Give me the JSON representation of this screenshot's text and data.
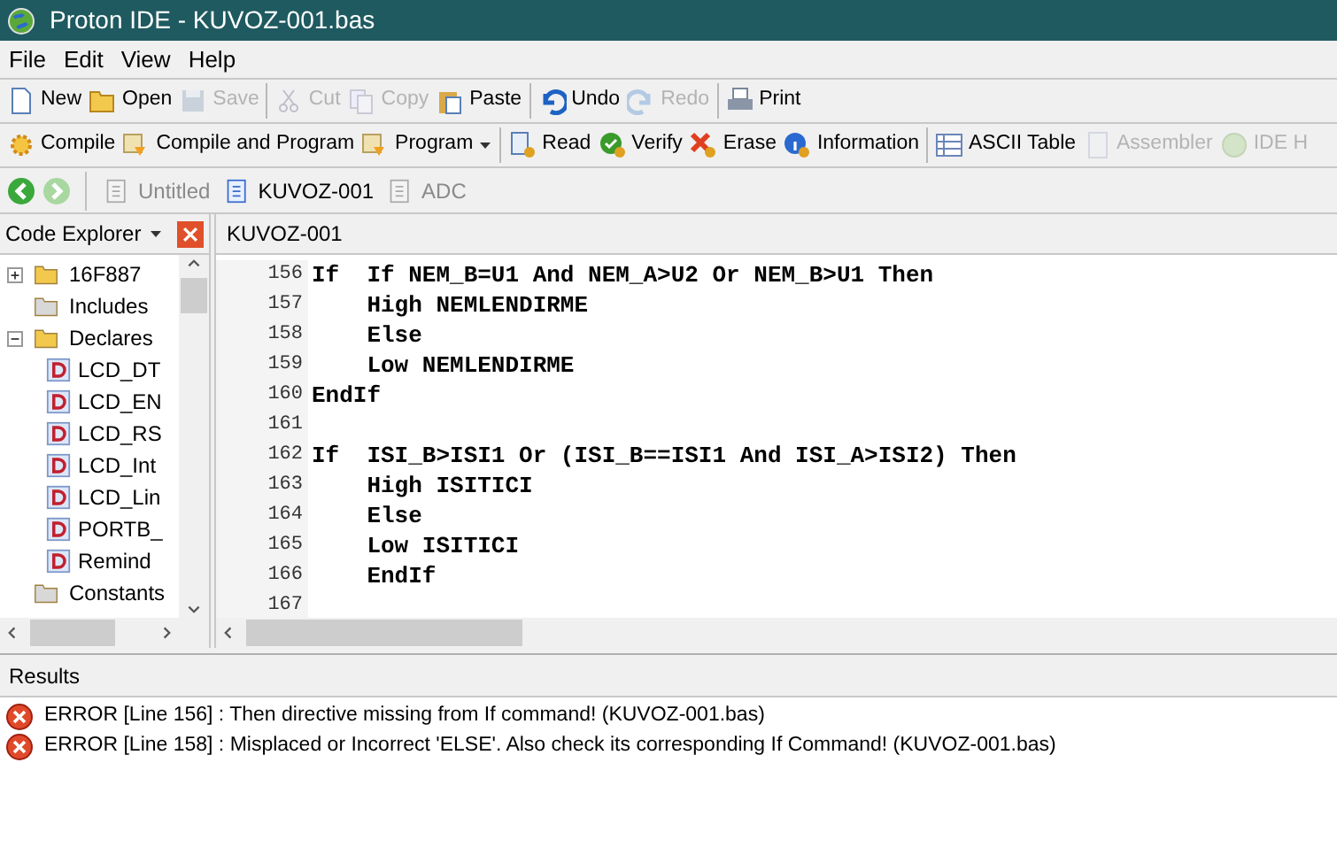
{
  "window": {
    "title": "Proton IDE - KUVOZ-001.bas"
  },
  "menu": [
    "File",
    "Edit",
    "View",
    "Help"
  ],
  "toolbars": [
    [
      [
        {
          "label": "New",
          "disabled": false
        },
        {
          "label": "Open",
          "disabled": false
        },
        {
          "label": "Save",
          "disabled": true
        }
      ],
      [
        {
          "label": "Cut",
          "disabled": true
        },
        {
          "label": "Copy",
          "disabled": true
        },
        {
          "label": "Paste",
          "disabled": false
        }
      ],
      [
        {
          "label": "Undo",
          "disabled": false
        },
        {
          "label": "Redo",
          "disabled": true
        }
      ],
      [
        {
          "label": "Print",
          "disabled": false
        }
      ]
    ],
    [
      [
        {
          "label": "Compile",
          "disabled": false
        },
        {
          "label": "Compile and Program",
          "disabled": false
        },
        {
          "label": "Program",
          "disabled": false,
          "dropdown": true
        }
      ],
      [
        {
          "label": "Read",
          "disabled": false
        },
        {
          "label": "Verify",
          "disabled": false
        },
        {
          "label": "Erase",
          "disabled": false
        },
        {
          "label": "Information",
          "disabled": false
        }
      ],
      [
        {
          "label": "ASCII Table",
          "disabled": false
        },
        {
          "label": "Assembler",
          "disabled": true
        },
        {
          "label": "IDE H",
          "disabled": true
        }
      ]
    ]
  ],
  "navigation": {
    "back_disabled": false,
    "forward_disabled": true
  },
  "document_tabs": [
    {
      "label": "Untitled",
      "selected": false
    },
    {
      "label": "KUVOZ-001",
      "selected": true
    },
    {
      "label": "ADC",
      "selected": false
    }
  ],
  "code_explorer": {
    "title": "Code Explorer",
    "items": [
      {
        "label": "16F887",
        "kind": "folder",
        "expanded": false
      },
      {
        "label": "Includes",
        "kind": "empty-folder"
      },
      {
        "label": "Declares",
        "kind": "folder",
        "expanded": true,
        "children": [
          {
            "label": "LCD_DT",
            "kind": "declare"
          },
          {
            "label": "LCD_EN",
            "kind": "declare"
          },
          {
            "label": "LCD_RS",
            "kind": "declare"
          },
          {
            "label": "LCD_Int",
            "kind": "declare"
          },
          {
            "label": "LCD_Lin",
            "kind": "declare"
          },
          {
            "label": "PORTB_",
            "kind": "declare"
          },
          {
            "label": "Remind",
            "kind": "declare"
          }
        ]
      },
      {
        "label": "Constants",
        "kind": "empty-folder"
      }
    ]
  },
  "editor": {
    "title": "KUVOZ-001",
    "lines": [
      {
        "number": "156",
        "text": "If  If NEM_B=U1 And NEM_A>U2 Or NEM_B>U1 Then"
      },
      {
        "number": "157",
        "text": "    High NEMLENDIRME"
      },
      {
        "number": "158",
        "text": "    Else"
      },
      {
        "number": "159",
        "text": "    Low NEMLENDIRME"
      },
      {
        "number": "160",
        "text": "EndIf"
      },
      {
        "number": "161"
      },
      {
        "number": "162",
        "text": "If  ISI_B>ISI1 Or (ISI_B==ISI1 And ISI_A>ISI2) Then"
      },
      {
        "number": "163",
        "text": "    High ISITICI"
      },
      {
        "number": "164",
        "text": "    Else"
      },
      {
        "number": "165",
        "text": "    Low ISITICI"
      },
      {
        "number": "166",
        "text": "    EndIf"
      },
      {
        "number": "167"
      }
    ]
  },
  "results": {
    "title": "Results",
    "messages": [
      {
        "kind": "error",
        "text": "ERROR [Line 156] : Then directive missing from If command! (KUVOZ-001.bas)"
      },
      {
        "kind": "error",
        "text": "ERROR [Line 158] : Misplaced or Incorrect 'ELSE'. Also check its corresponding If Command! (KUVOZ-001.bas)"
      }
    ]
  }
}
